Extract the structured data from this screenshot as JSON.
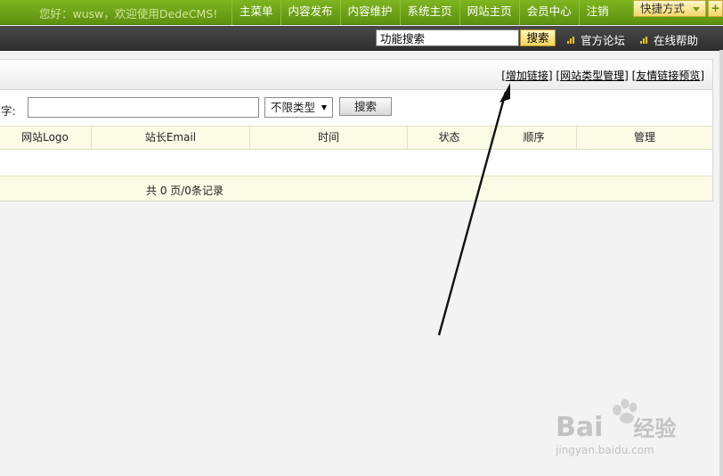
{
  "topbar": {
    "greeting": "您好：wusw，欢迎使用DedeCMS!",
    "nav": [
      "主菜单",
      "内容发布",
      "内容维护",
      "系统主页",
      "网站主页",
      "会员中心",
      "注销"
    ],
    "quick_label": "快捷方式",
    "plus_label": "+"
  },
  "darkbar": {
    "search_value": "功能搜索",
    "search_button": "搜索",
    "links": [
      "官方论坛",
      "在线帮助"
    ]
  },
  "panel": {
    "header_links": [
      "增加链接",
      "网站类型管理",
      "友情链接预览"
    ],
    "keyword_label": "字:",
    "keyword_value": "",
    "type_selected": "不限类型",
    "search_button": "搜索",
    "columns": [
      "网站Logo",
      "站长Email",
      "时间",
      "状态",
      "顺序",
      "管理"
    ],
    "footer": "共 0 页/0条记录"
  },
  "watermark": {
    "logo": "Bai",
    "logo2": "经验",
    "url": "jingyan.baidu.com"
  },
  "colors": {
    "topbar": "#6fa317",
    "darkbar": "#3a3a3a",
    "table_header_bg": "#fbfbe6"
  }
}
